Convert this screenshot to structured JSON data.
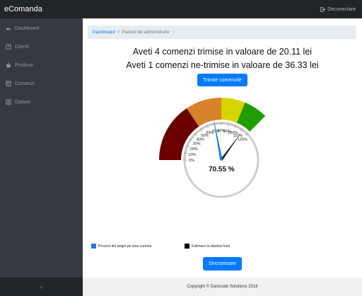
{
  "app": {
    "brand": "eComanda",
    "logout_label": "Deconectare"
  },
  "sidebar": {
    "items": [
      {
        "label": "Dashboard",
        "icon": "dashboard-icon"
      },
      {
        "label": "Clienti",
        "icon": "clients-icon"
      },
      {
        "label": "Produse",
        "icon": "products-icon"
      },
      {
        "label": "Comenzi",
        "icon": "orders-icon"
      },
      {
        "label": "Optiuni",
        "icon": "options-icon"
      }
    ],
    "collapse_glyph": "‹"
  },
  "breadcrumb": {
    "home": "Dashboard",
    "separator": "/",
    "current": "Panoul de administrare"
  },
  "summary": {
    "sent": "Aveti 4 comenzi trimise in valoare de 20.11 lei",
    "unsent": "Aveti 1 comenzi ne-trimise in valoare de 36.33 lei"
  },
  "send_button": "Trimite comenzile",
  "gauge": {
    "value_label": "70.55 %",
    "value": 70.55,
    "estimate": 112,
    "max": 120,
    "ticks": [
      "0%",
      "10%",
      "20%",
      "30%",
      "40%",
      "50%",
      "60%",
      "70%",
      "80%",
      "90%",
      "100%",
      "110%",
      "120%"
    ],
    "colors": {
      "red": "#6b0000",
      "orange": "#d8822c",
      "yellow": "#d8d400",
      "green": "#1e9e00",
      "needle": "#1e7fd6",
      "estimate_needle": "#222222"
    }
  },
  "legend": [
    {
      "label": "Procent din target pe luna curenta",
      "color": "#1e7fd6"
    },
    {
      "label": "Estimare la sfarsitul lunii",
      "color": "#000000"
    }
  ],
  "sync_button": "Sincronizare",
  "footer": "Copyright © Danicode Solutions 2018"
}
